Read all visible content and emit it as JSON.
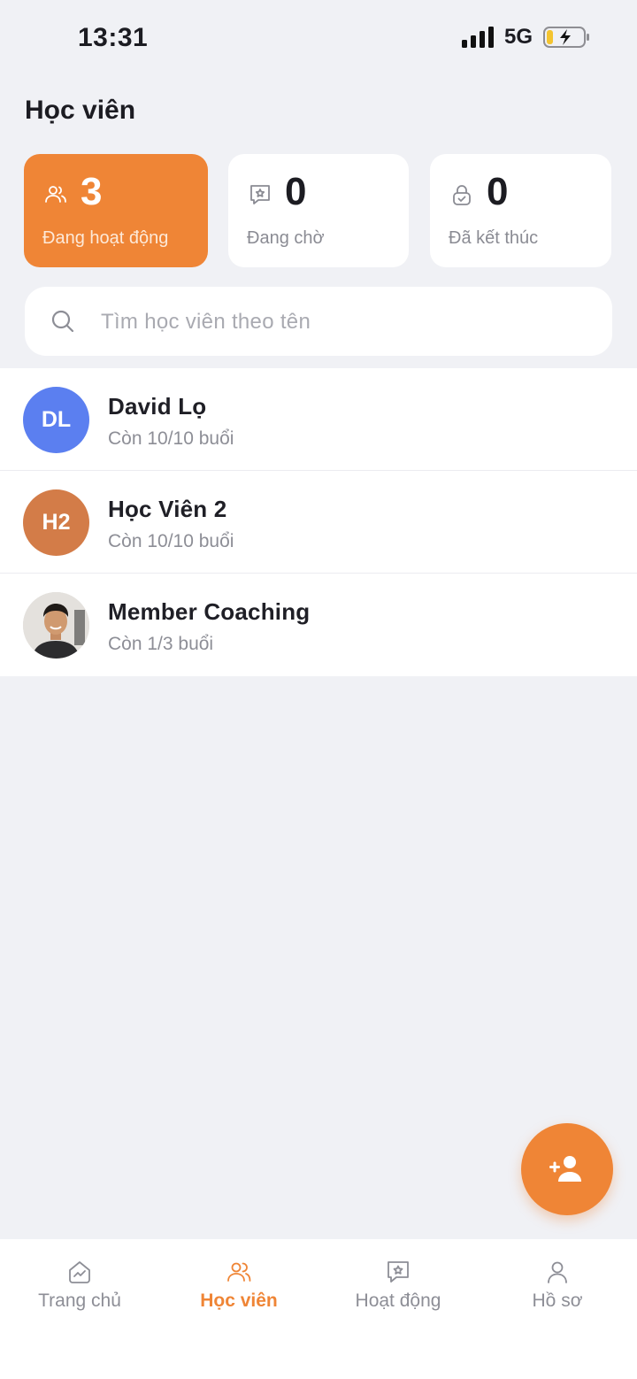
{
  "status_bar": {
    "time": "13:31",
    "network": "5G"
  },
  "page": {
    "title": "Học viên"
  },
  "stats": [
    {
      "count": "3",
      "label": "Đang hoạt động",
      "icon": "users-icon",
      "active": true
    },
    {
      "count": "0",
      "label": "Đang chờ",
      "icon": "star-message-icon",
      "active": false
    },
    {
      "count": "0",
      "label": "Đã kết thúc",
      "icon": "lock-check-icon",
      "active": false
    }
  ],
  "search": {
    "placeholder": "Tìm học viên theo tên"
  },
  "members": [
    {
      "initials": "DL",
      "name": "David Lọ",
      "sessions": "Còn 10/10 buổi",
      "avatar_color": "#5b7ff0"
    },
    {
      "initials": "H2",
      "name": "Học Viên 2",
      "sessions": "Còn 10/10 buổi",
      "avatar_color": "#d37c48"
    },
    {
      "initials": "",
      "name": "Member Coaching",
      "sessions": "Còn 1/3 buổi",
      "avatar_color": "#d9d6d2",
      "avatar_type": "photo"
    }
  ],
  "fab": {
    "icon": "add-user-icon"
  },
  "bottom_nav": {
    "items": [
      {
        "label": "Trang chủ",
        "icon": "home-chart-icon",
        "active": false
      },
      {
        "label": "Học viên",
        "icon": "users-icon",
        "active": true
      },
      {
        "label": "Hoạt động",
        "icon": "star-message-icon",
        "active": false
      },
      {
        "label": "Hồ sơ",
        "icon": "profile-icon",
        "active": false
      }
    ]
  },
  "colors": {
    "accent": "#ef8536",
    "background": "#f0f1f5"
  }
}
